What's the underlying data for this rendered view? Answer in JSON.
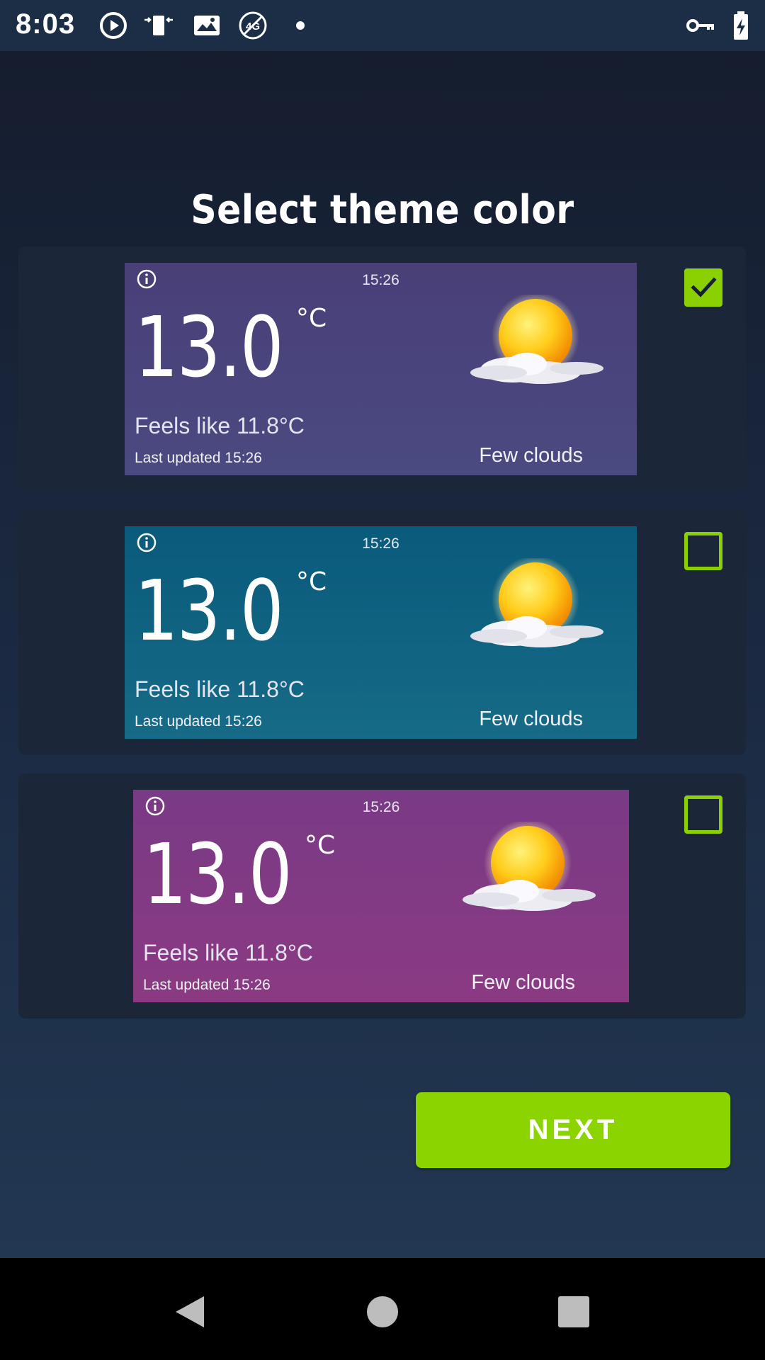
{
  "status_bar": {
    "time": "8:03",
    "icons": [
      "play-circle-icon",
      "fit-screen-icon",
      "photo-sticker-icon",
      "no-4g-icon",
      "notification-dot-icon",
      "vpn-key-icon",
      "battery-charging-icon"
    ],
    "no_4g_label": "4G"
  },
  "page": {
    "title": "Select theme color"
  },
  "themes": [
    {
      "name": "purple",
      "selected": true,
      "colors": [
        "#4a3f78",
        "#4a4a80"
      ],
      "preview": {
        "time": "15:26",
        "temperature": "13.0",
        "unit": "°C",
        "feels_like": "Feels like 11.8°C",
        "last_updated": "Last updated 15:26",
        "condition": "Few clouds",
        "icon": "sun-cloud-icon"
      }
    },
    {
      "name": "teal",
      "selected": false,
      "colors": [
        "#0a5a7c",
        "#166b86"
      ],
      "preview": {
        "time": "15:26",
        "temperature": "13.0",
        "unit": "°C",
        "feels_like": "Feels like 11.8°C",
        "last_updated": "Last updated 15:26",
        "condition": "Few clouds",
        "icon": "sun-cloud-icon"
      }
    },
    {
      "name": "magenta",
      "selected": false,
      "colors": [
        "#7a3a86",
        "#8a3a82"
      ],
      "preview": {
        "time": "15:26",
        "temperature": "13.0",
        "unit": "°C",
        "feels_like": "Feels like 11.8°C",
        "last_updated": "Last updated 15:26",
        "condition": "Few clouds",
        "icon": "sun-cloud-icon"
      }
    }
  ],
  "next_button": {
    "label": "NEXT",
    "color": "#8bd400"
  },
  "nav_bar": {
    "icons": [
      "back-icon",
      "home-icon",
      "recents-icon"
    ]
  }
}
